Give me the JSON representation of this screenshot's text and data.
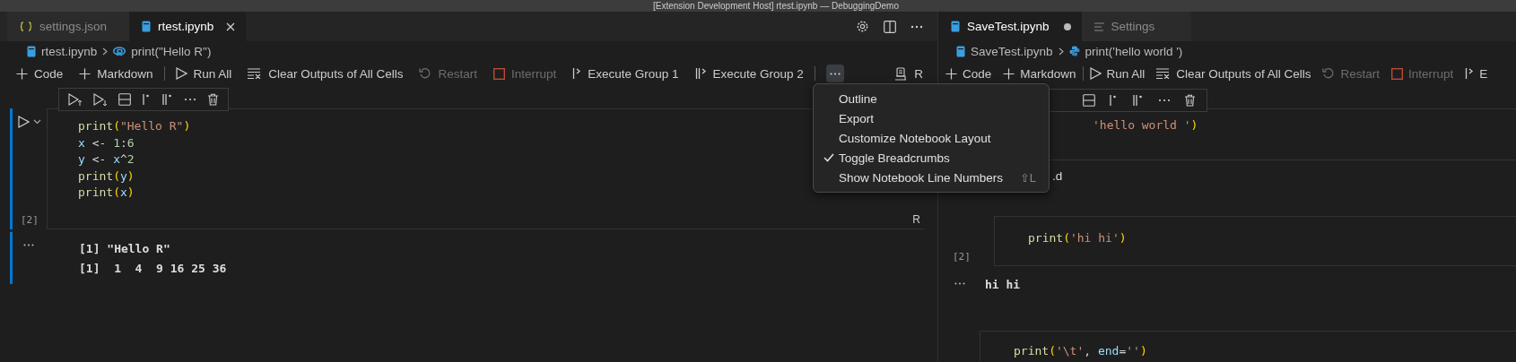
{
  "window": {
    "title": "[Extension Development Host] rtest.ipynb — DebuggingDemo"
  },
  "left_pane": {
    "tabs": [
      {
        "label": "settings.json",
        "kind": "json",
        "selected": false
      },
      {
        "label": "rtest.ipynb",
        "kind": "notebook",
        "selected": true
      }
    ],
    "breadcrumb": [
      {
        "label": "rtest.ipynb",
        "kind": "notebook"
      },
      {
        "label": "print(\"Hello R\")",
        "kind": "r"
      }
    ],
    "toolbar": [
      [
        {
          "label": "Code",
          "kind": "add",
          "disabled": false
        },
        {
          "label": "Markdown",
          "kind": "add",
          "disabled": false
        }
      ],
      [
        {
          "label": "Run All",
          "kind": "run",
          "disabled": false
        },
        {
          "label": "Clear Outputs of All Cells",
          "kind": "clear",
          "disabled": false
        },
        {
          "label": "Restart",
          "kind": "restart",
          "disabled": true
        },
        {
          "label": "Interrupt",
          "kind": "interrupt",
          "disabled": true
        },
        {
          "label": "Execute Group 1",
          "kind": "group1",
          "disabled": false
        },
        {
          "label": "Execute Group 2",
          "kind": "group2",
          "disabled": false
        }
      ]
    ],
    "more_button": {
      "expanded": true
    },
    "kernel": "R",
    "cell": {
      "exec_count": "[2]",
      "language": "R",
      "lines": [
        [
          {
            "text": "print",
            "kind": "fn"
          },
          {
            "text": "(",
            "kind": "paren"
          },
          {
            "text": "\"Hello R\"",
            "kind": "str"
          },
          {
            "text": ")",
            "kind": "paren"
          }
        ],
        [
          {
            "text": "x",
            "kind": "var"
          },
          {
            "text": " <- ",
            "kind": "op"
          },
          {
            "text": "1",
            "kind": "num"
          },
          {
            "text": ":",
            "kind": "op"
          },
          {
            "text": "6",
            "kind": "num"
          }
        ],
        [
          {
            "text": "y",
            "kind": "var"
          },
          {
            "text": " <- ",
            "kind": "op"
          },
          {
            "text": "x",
            "kind": "var"
          },
          {
            "text": "^",
            "kind": "op"
          },
          {
            "text": "2",
            "kind": "num"
          }
        ],
        [
          {
            "text": "print",
            "kind": "fn"
          },
          {
            "text": "(",
            "kind": "paren"
          },
          {
            "text": "y",
            "kind": "var"
          },
          {
            "text": ")",
            "kind": "paren"
          }
        ],
        [
          {
            "text": "print",
            "kind": "fn"
          },
          {
            "text": "(",
            "kind": "paren"
          },
          {
            "text": "x",
            "kind": "var"
          },
          {
            "text": ")",
            "kind": "paren"
          }
        ]
      ],
      "output": [
        "[1] \"Hello R\"",
        "[1]  1  4  9 16 25 36"
      ]
    }
  },
  "menu": {
    "items": [
      {
        "label": "Outline",
        "checked": false
      },
      {
        "label": "Export",
        "checked": false
      },
      {
        "label": "Customize Notebook Layout",
        "checked": false
      },
      {
        "label": "Toggle Breadcrumbs",
        "checked": true
      },
      {
        "label": "Show Notebook Line Numbers",
        "checked": false,
        "shortcut": "⇧L"
      }
    ]
  },
  "right_pane": {
    "tabs": [
      {
        "label": "SaveTest.ipynb",
        "kind": "notebook",
        "selected": true,
        "dirty": true
      },
      {
        "label": "Settings",
        "kind": "settings",
        "selected": false,
        "dirty": false
      }
    ],
    "breadcrumb": [
      {
        "label": "SaveTest.ipynb",
        "kind": "notebook"
      },
      {
        "label": "print('hello world ')",
        "kind": "python"
      }
    ],
    "toolbar": [
      [
        {
          "label": "Code",
          "kind": "add",
          "disabled": false
        },
        {
          "label": "Markdown",
          "kind": "add",
          "disabled": false
        }
      ],
      [
        {
          "label": "Run All",
          "kind": "run",
          "disabled": false
        },
        {
          "label": "Clear Outputs of All Cells",
          "kind": "clear",
          "disabled": false
        },
        {
          "label": "Restart",
          "kind": "restart",
          "disabled": true
        },
        {
          "label": "Interrupt",
          "kind": "interrupt",
          "disabled": true
        },
        {
          "label": "E",
          "kind": "group1",
          "disabled": false
        }
      ]
    ],
    "first_cell": [
      {
        "text": "'hello world '",
        "kind": "str"
      },
      {
        "text": ")",
        "kind": "paren"
      }
    ],
    "markdown_fragment": ".d",
    "cell": {
      "exec_count": "[2]",
      "lines": [
        [
          {
            "text": "print",
            "kind": "fn"
          },
          {
            "text": "(",
            "kind": "paren"
          },
          {
            "text": "'hi hi'",
            "kind": "str"
          },
          {
            "text": ")",
            "kind": "paren"
          }
        ]
      ],
      "output": [
        "hi hi"
      ]
    },
    "next_cell": {
      "lines": [
        [
          {
            "text": "print",
            "kind": "fn"
          },
          {
            "text": "(",
            "kind": "paren"
          },
          {
            "text": "'\\t'",
            "kind": "str"
          },
          {
            "text": ", ",
            "kind": "op"
          },
          {
            "text": "end",
            "kind": "var"
          },
          {
            "text": "=",
            "kind": "op"
          },
          {
            "text": "''",
            "kind": "str"
          },
          {
            "text": ")",
            "kind": "paren"
          }
        ]
      ]
    }
  }
}
